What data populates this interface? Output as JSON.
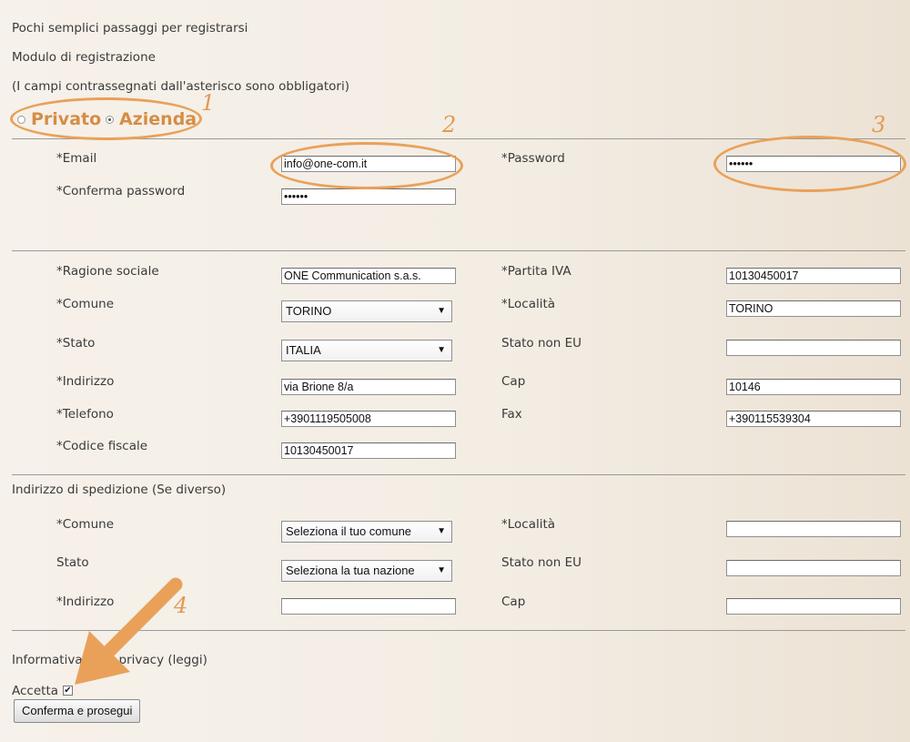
{
  "header": {
    "steps_text": "Pochi semplici passaggi per registrarsi",
    "form_title": "Modulo di registrazione",
    "required_note": "(I campi contrassegnati dall'asterisco sono obbligatori)"
  },
  "account_type": {
    "options": [
      {
        "label": "Privato",
        "selected": false
      },
      {
        "label": "Azienda",
        "selected": true
      }
    ]
  },
  "annotations": [
    "1",
    "2",
    "3",
    "4"
  ],
  "annotation_color": "#e9a15a",
  "login": {
    "email_label": "*Email",
    "email_value": "info@one-com.it",
    "password_label": "*Password",
    "password_value": "••••••",
    "confirm_label": "*Conferma password",
    "confirm_value": "••••••"
  },
  "company": {
    "ragione_label": "*Ragione sociale",
    "ragione_value": "ONE Communication s.a.s.",
    "piva_label": "*Partita IVA",
    "piva_value": "10130450017",
    "comune_label": "*Comune",
    "comune_value": "TORINO",
    "localita_label": "*Località",
    "localita_value": "TORINO",
    "stato_label": "*Stato",
    "stato_value": "ITALIA",
    "stato_non_eu_label": "Stato non EU",
    "stato_non_eu_value": "",
    "indirizzo_label": "*Indirizzo",
    "indirizzo_value": "via Brione 8/a",
    "cap_label": "Cap",
    "cap_value": "10146",
    "telefono_label": "*Telefono",
    "telefono_value": "+3901119505008",
    "fax_label": "Fax",
    "fax_value": "+390115539304",
    "cf_label": "*Codice fiscale",
    "cf_value": "10130450017"
  },
  "shipping": {
    "title": "Indirizzo di spedizione (Se diverso)",
    "comune_label": "*Comune",
    "comune_value": "Seleziona il tuo comune",
    "localita_label": "*Località",
    "localita_value": "",
    "stato_label": "Stato",
    "stato_value": "Seleziona la tua nazione",
    "stato_non_eu_label": "Stato non EU",
    "stato_non_eu_value": "",
    "indirizzo_label": "*Indirizzo",
    "indirizzo_value": "",
    "cap_label": "Cap",
    "cap_value": ""
  },
  "privacy": {
    "text": "Informativa sulla privacy (leggi)",
    "accept_label": "Accetta",
    "accepted": true,
    "submit_label": "Conferma e prosegui"
  }
}
